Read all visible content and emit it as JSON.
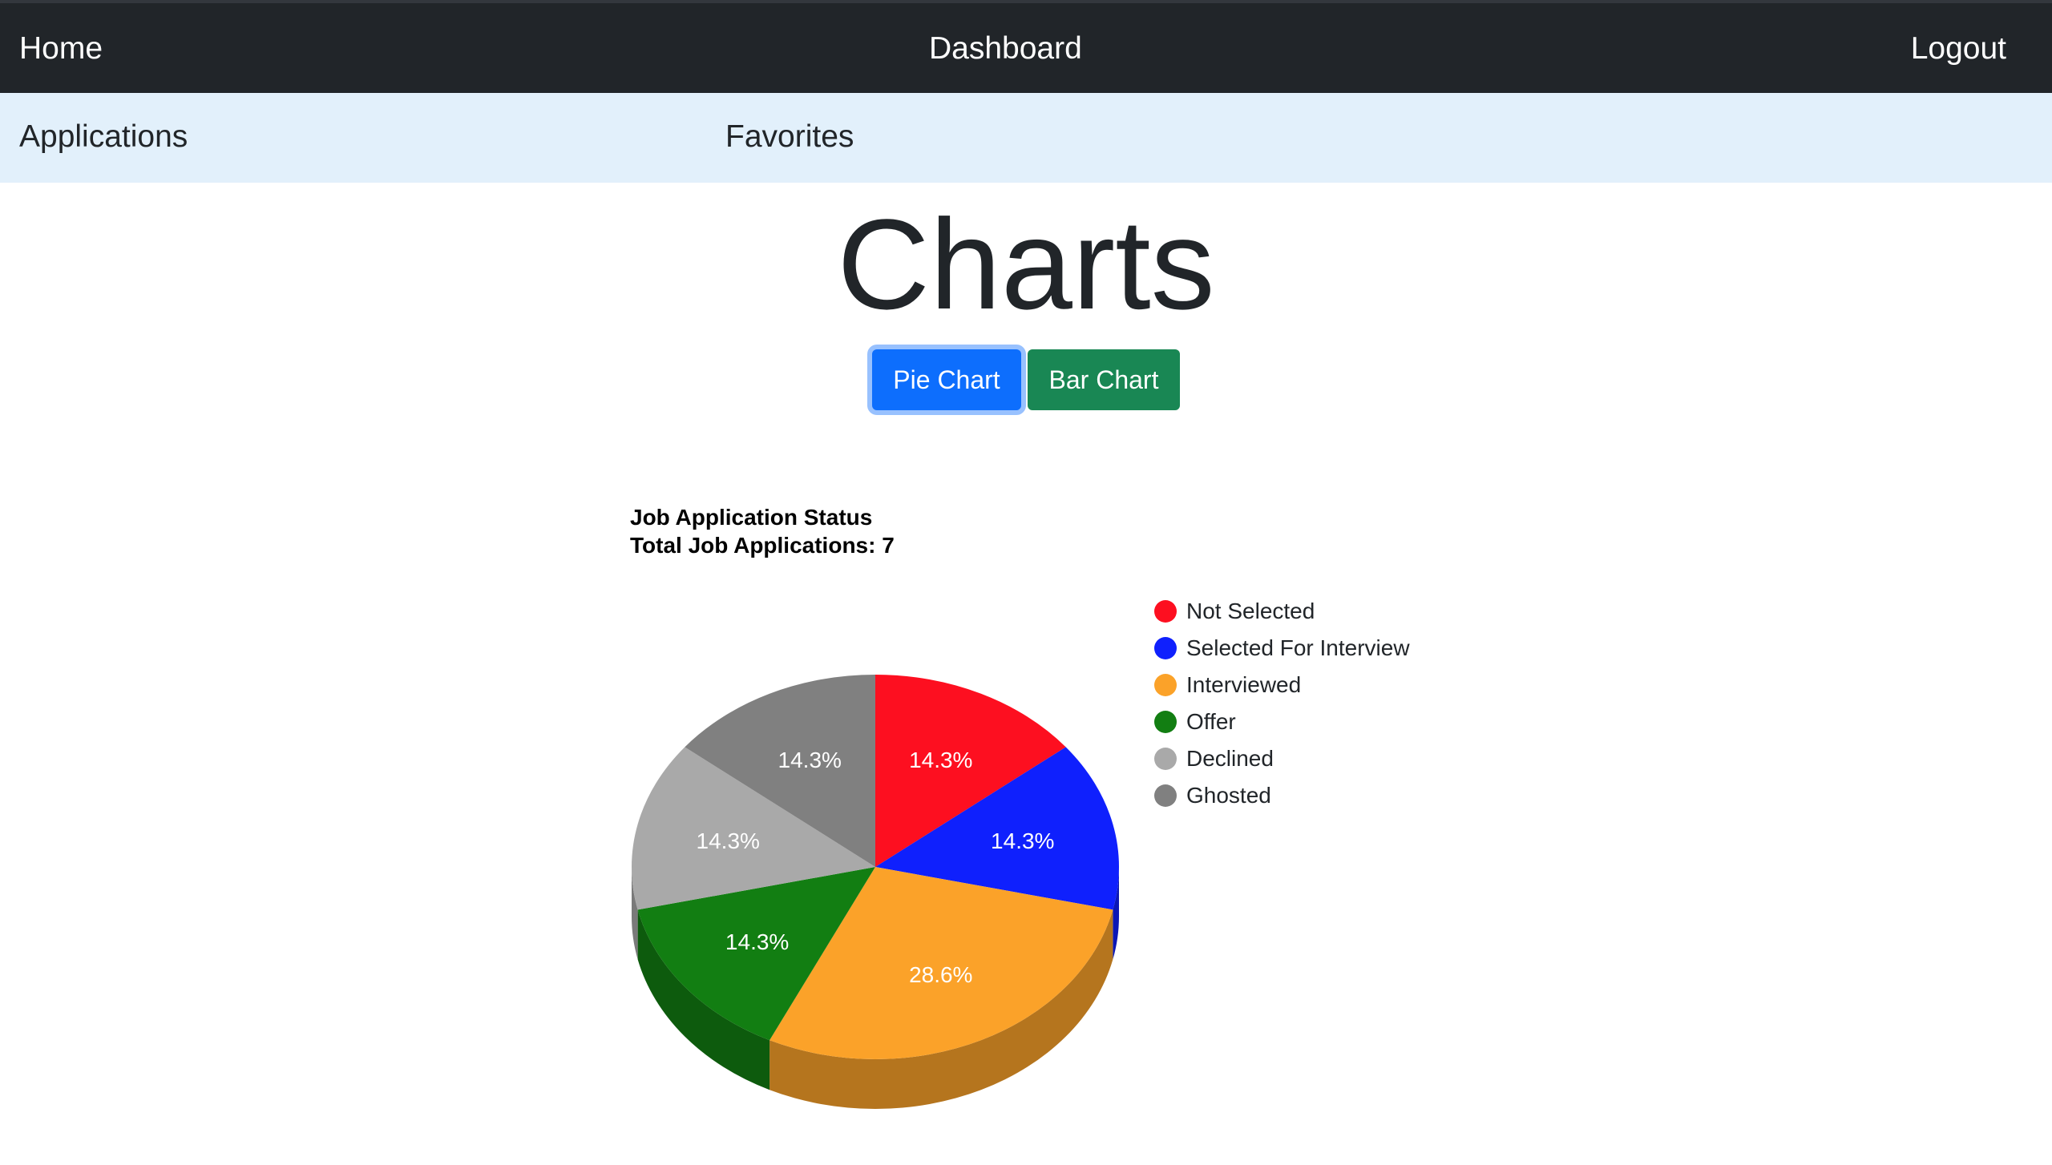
{
  "topnav": {
    "home": "Home",
    "dashboard": "Dashboard",
    "logout": "Logout"
  },
  "subnav": {
    "applications": "Applications",
    "favorites": "Favorites"
  },
  "page": {
    "title": "Charts"
  },
  "buttons": {
    "pie_chart": "Pie Chart",
    "bar_chart": "Bar Chart"
  },
  "chart_data": {
    "type": "pie",
    "title": "Job Application Status",
    "subtitle": "Total Job Applications: 7",
    "style": "3d",
    "legend_position": "right",
    "slices": [
      {
        "label": "Not Selected",
        "value": 1,
        "percent": "14.3%",
        "color": "#fd0f20"
      },
      {
        "label": "Selected For Interview",
        "value": 1,
        "percent": "14.3%",
        "color": "#0f20fd"
      },
      {
        "label": "Interviewed",
        "value": 2,
        "percent": "28.6%",
        "color": "#fba229"
      },
      {
        "label": "Offer",
        "value": 1,
        "percent": "14.3%",
        "color": "#127e12"
      },
      {
        "label": "Declined",
        "value": 1,
        "percent": "14.3%",
        "color": "#a9a9a9"
      },
      {
        "label": "Ghosted",
        "value": 1,
        "percent": "14.3%",
        "color": "#808080"
      }
    ]
  }
}
